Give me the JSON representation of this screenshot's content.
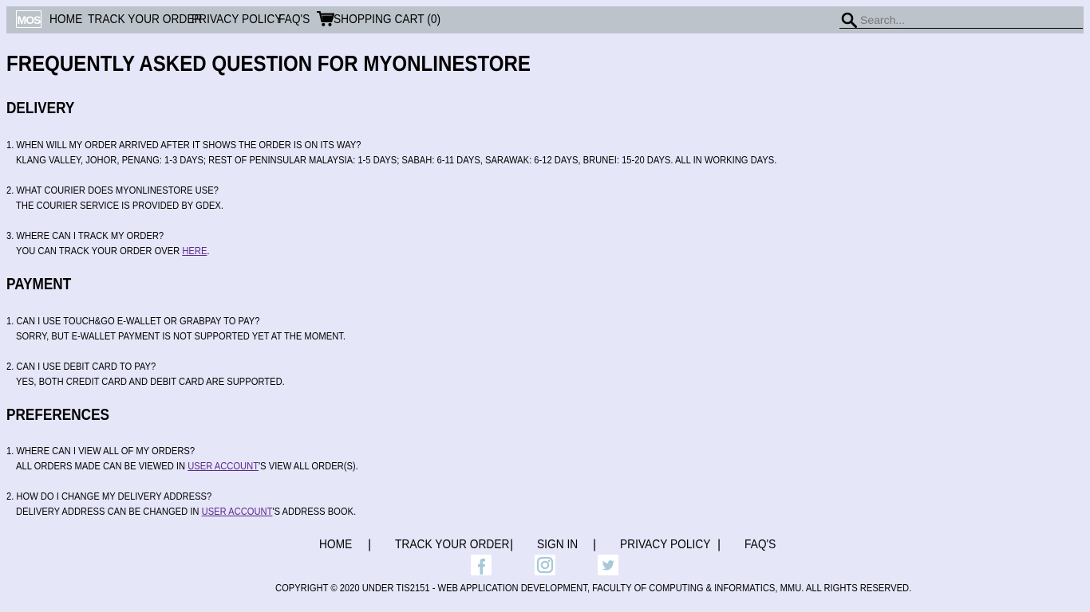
{
  "nav": {
    "logo_text": "MOS",
    "items": [
      "HOME",
      "TRACK YOUR ORDER",
      "PRIVACY POLICY",
      "FAQ'S"
    ],
    "cart_label": "SHOPPING CART (0)",
    "search_placeholder": "Search..."
  },
  "page": {
    "title": "FREQUENTLY ASKED QUESTION FOR MYONLINESTORE",
    "sections": [
      {
        "heading": "DELIVERY",
        "qas": [
          {
            "q": "1. WHEN WILL MY ORDER ARRIVED AFTER IT SHOWS THE ORDER IS ON ITS WAY?",
            "a": "KLANG VALLEY, JOHOR, PENANG: 1-3 DAYS; REST OF PENINSULAR MALAYSIA: 1-5 DAYS; SABAH: 6-11 DAYS, SARAWAK: 6-12 DAYS, BRUNEI: 15-20 DAYS. ALL IN WORKING DAYS."
          },
          {
            "q": "2. WHAT COURIER DOES MYONLINESTORE USE?",
            "a": "THE COURIER SERVICE IS PROVIDED BY GDEX."
          },
          {
            "q": "3. WHERE CAN I TRACK MY ORDER?",
            "a_pre": "YOU CAN TRACK YOUR ORDER OVER ",
            "a_link": "HERE",
            "a_post": "."
          }
        ]
      },
      {
        "heading": "PAYMENT",
        "qas": [
          {
            "q": "1. CAN I USE TOUCH&GO E-WALLET OR GRABPAY TO PAY?",
            "a": "SORRY, BUT E-WALLET PAYMENT IS NOT SUPPORTED YET AT THE MOMENT."
          },
          {
            "q": "2. CAN I USE DEBIT CARD TO PAY?",
            "a": "YES, BOTH CREDIT CARD AND DEBIT CARD ARE SUPPORTED."
          }
        ]
      },
      {
        "heading": "PREFERENCES",
        "qas": [
          {
            "q": "1. WHERE CAN I VIEW ALL OF MY ORDERS?",
            "a_pre": "ALL ORDERS MADE CAN BE VIEWED IN ",
            "a_link": "USER ACCOUNT",
            "a_post": "'S VIEW ALL ORDER(S)."
          },
          {
            "q": "2. HOW DO I CHANGE MY DELIVERY ADDRESS?",
            "a_pre": "DELIVERY ADDRESS CAN BE CHANGED IN ",
            "a_link": "USER ACCOUNT",
            "a_post": "'S ADDRESS BOOK."
          }
        ]
      }
    ]
  },
  "footer": {
    "links": [
      "HOME",
      "TRACK YOUR ORDER",
      "SIGN IN",
      "PRIVACY POLICY",
      "FAQ'S"
    ],
    "separator": "|",
    "social_icons": [
      "facebook-icon",
      "instagram-icon",
      "twitter-icon"
    ],
    "copyright": "COPYRIGHT © 2020 UNDER TIS2151 - WEB APPLICATION DEVELOPMENT, FACULTY OF COMPUTING & INFORMATICS, MMU. ALL RIGHTS RESERVED."
  },
  "colors": {
    "page_bg": "#e6e6f9",
    "navbar_bg": "#bcc3cb",
    "link": "#5a2a8a",
    "social_icon": "#a6c8d8"
  }
}
